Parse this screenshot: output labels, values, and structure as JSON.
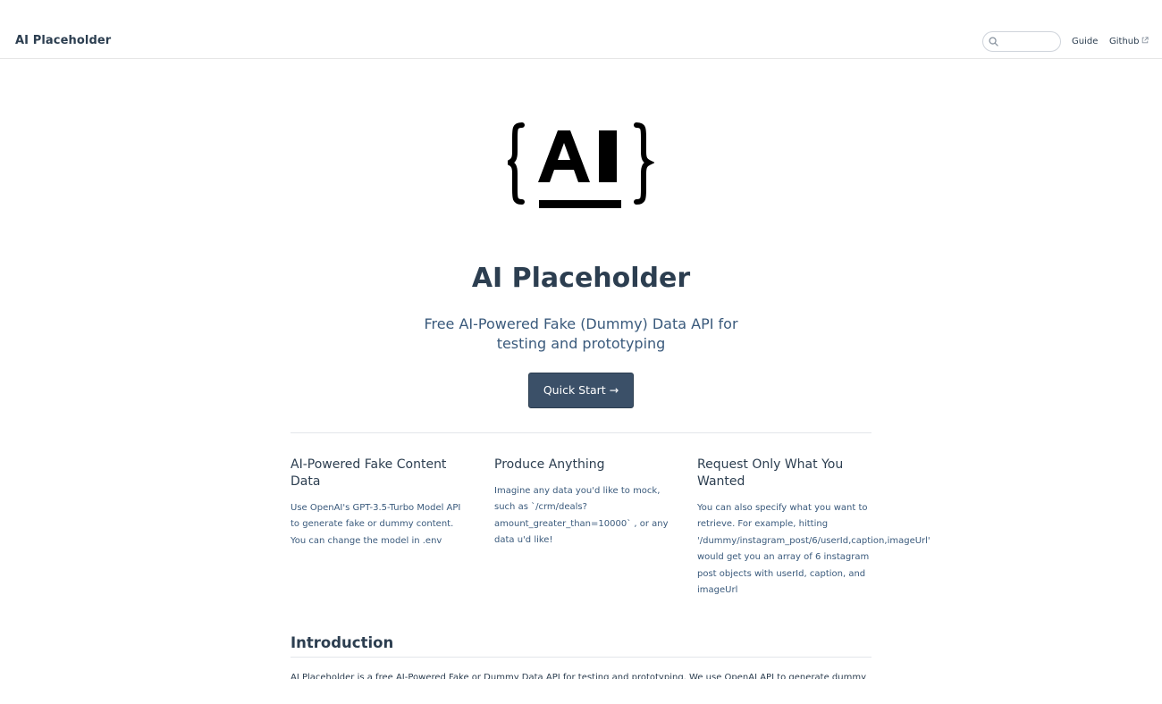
{
  "header": {
    "site_title": "AI Placeholder",
    "search": {
      "placeholder": "",
      "value": ""
    },
    "nav": {
      "guide": "Guide",
      "github": "Github"
    }
  },
  "hero": {
    "logo_icon": "ai-braces-logo",
    "title": "AI Placeholder",
    "tagline": "Free AI-Powered Fake (Dummy) Data API for testing and prototyping",
    "cta": "Quick Start →"
  },
  "features": [
    {
      "title": "AI-Powered Fake Content Data",
      "lines": [
        "Use OpenAI's GPT-3.5-Turbo Model API",
        "to generate fake or dummy content.",
        "You can change the model in .env"
      ]
    },
    {
      "title": "Produce Anything",
      "lines": [
        "Imagine any data you'd like to mock,",
        "such as `/crm/deals?",
        "amount_greater_than=10000` , or any",
        "data u'd like!"
      ]
    },
    {
      "title": "Request Only What You Wanted",
      "lines": [
        "You can also specify what you want to",
        "retrieve. For example, hitting",
        "'/dummy/instagram_post/6/userId,caption,imageUrl'",
        "would get you an array of 6 instagram",
        "post objects with userId, caption, and",
        "imageUrl"
      ]
    }
  ],
  "intro": {
    "heading": "Introduction",
    "text": "AI Placeholder is a free AI-Powered Fake or Dummy Data API for testing and prototyping. We use OpenAI API to generate dummy"
  },
  "colors": {
    "primary": "#2c3e50",
    "button_bg": "#3b5068",
    "text_muted": "#3a5a7c",
    "border": "#e6e6e6"
  }
}
